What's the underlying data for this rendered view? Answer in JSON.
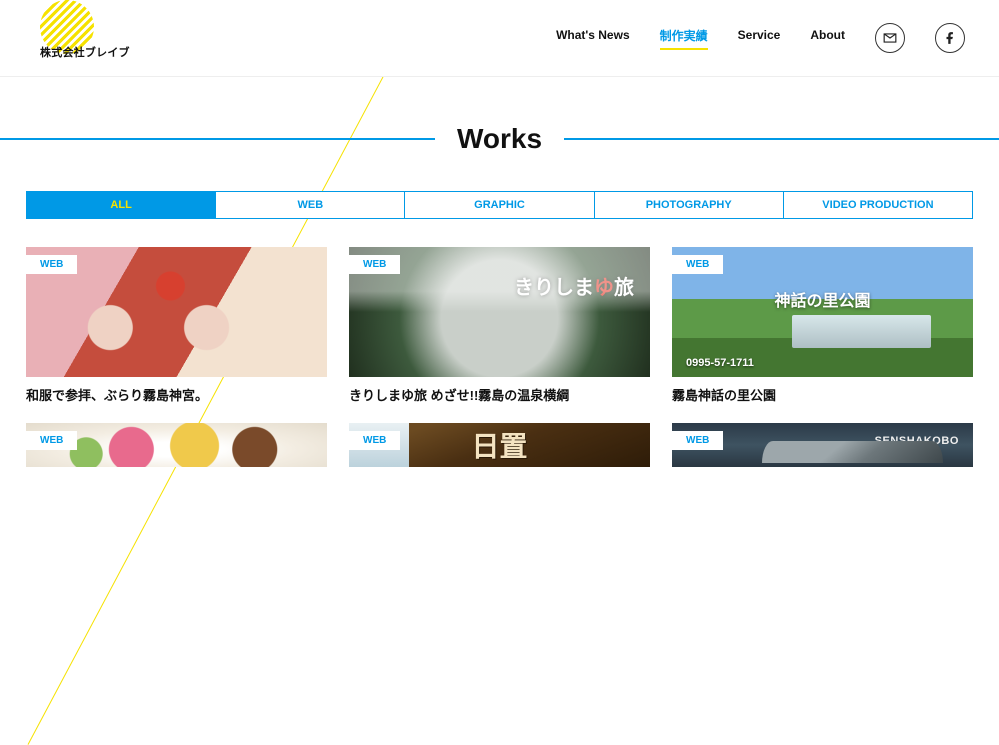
{
  "header": {
    "logo_text": "株式会社ブレイブ",
    "nav": [
      {
        "label": "What's News",
        "active": false
      },
      {
        "label": "制作実績",
        "active": true
      },
      {
        "label": "Service",
        "active": false
      },
      {
        "label": "About",
        "active": false
      }
    ]
  },
  "page_title": "Works",
  "tabs": [
    {
      "label": "ALL",
      "active": true
    },
    {
      "label": "WEB",
      "active": false
    },
    {
      "label": "GRAPHIC",
      "active": false
    },
    {
      "label": "PHOTOGRAPHY",
      "active": false
    },
    {
      "label": "VIDEO PRODUCTION",
      "active": false
    }
  ],
  "cards": [
    {
      "badge": "WEB",
      "title": "和服で参拝、ぶらり霧島神宮。"
    },
    {
      "badge": "WEB",
      "title": "きりしまゆ旅 めざせ!!霧島の温泉横綱",
      "overlay_prefix": "きりしま",
      "overlay_accent": "ゆ",
      "overlay_suffix": "旅"
    },
    {
      "badge": "WEB",
      "title": "霧島神話の里公園",
      "overlay_park": "神話の里公園",
      "overlay_tel": "0995-57-1711"
    },
    {
      "badge": "WEB",
      "title": ""
    },
    {
      "badge": "WEB",
      "title": "",
      "overlay_sign": "日置"
    },
    {
      "badge": "WEB",
      "title": "",
      "overlay_brand": "SENSHAKOBO"
    }
  ],
  "colors": {
    "accent_blue": "#0099e6",
    "accent_yellow": "#f6e200"
  }
}
